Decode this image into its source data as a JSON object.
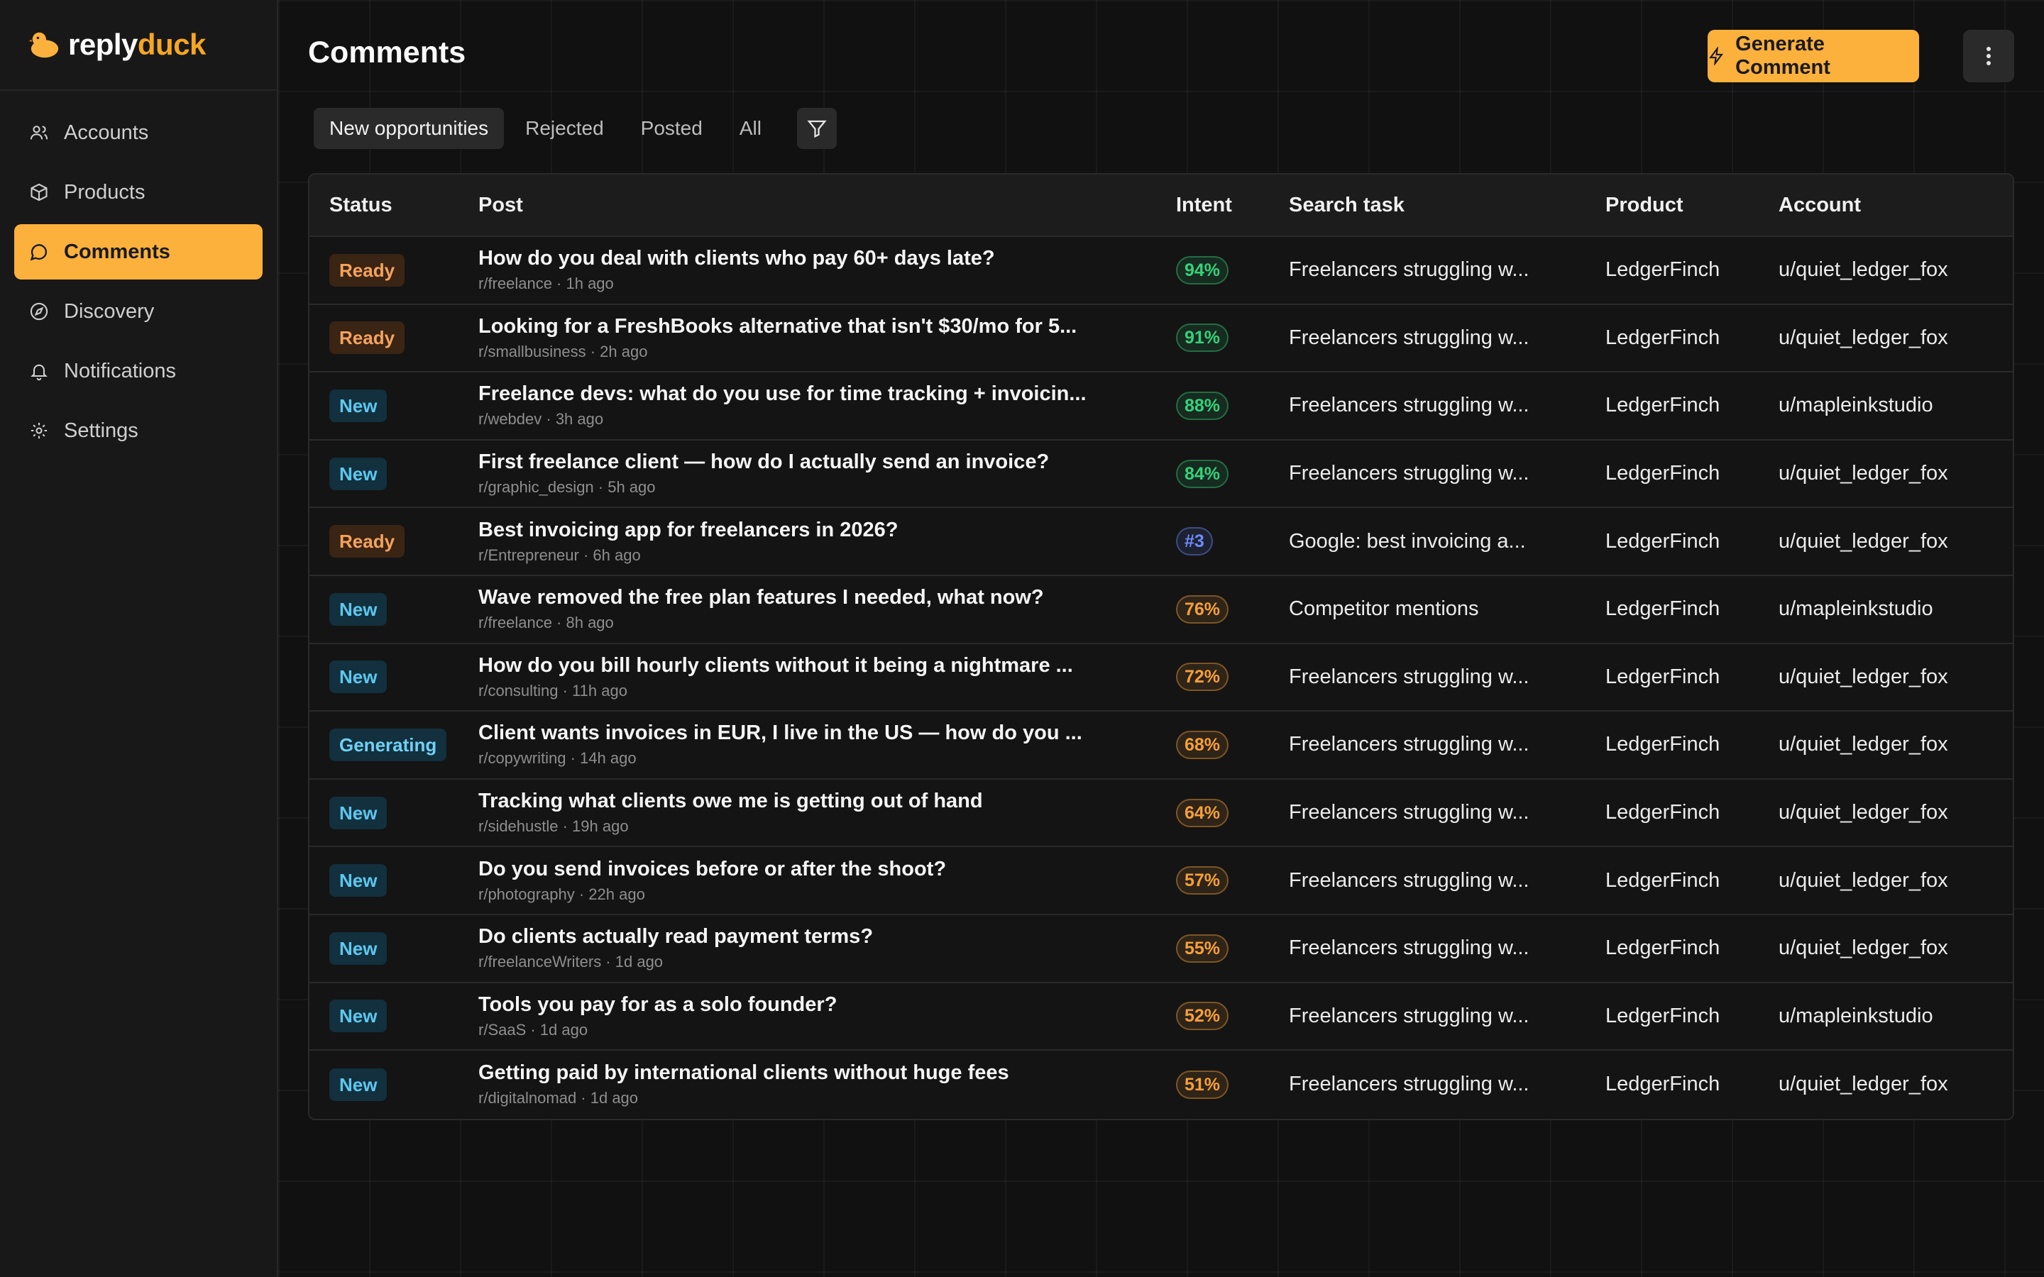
{
  "app": {
    "brand_part1": "reply",
    "brand_part2": "duck",
    "brand_color": "#f5a623"
  },
  "sidebar": {
    "items": [
      {
        "label": "Accounts",
        "icon": "users-icon"
      },
      {
        "label": "Products",
        "icon": "box-icon"
      },
      {
        "label": "Comments",
        "icon": "chat-icon",
        "active": true
      },
      {
        "label": "Discovery",
        "icon": "compass-icon"
      },
      {
        "label": "Notifications",
        "icon": "bell-icon"
      },
      {
        "label": "Settings",
        "icon": "gear-icon"
      }
    ]
  },
  "header": {
    "title": "Comments",
    "generate_label": "Generate Comment"
  },
  "tabs": [
    {
      "label": "New opportunities",
      "active": true
    },
    {
      "label": "Rejected"
    },
    {
      "label": "Posted"
    },
    {
      "label": "All"
    }
  ],
  "table": {
    "columns": [
      "Status",
      "Post",
      "Intent",
      "Search task",
      "Product",
      "Account"
    ],
    "rows": [
      {
        "status": "Ready",
        "title": "How do you deal with clients who pay 60+ days late?",
        "meta": "r/freelance · 1h ago",
        "intent": "94%",
        "intent_level": "high",
        "task": "Freelancers struggling w...",
        "product": "LedgerFinch",
        "account": "u/quiet_ledger_fox"
      },
      {
        "status": "Ready",
        "title": "Looking for a FreshBooks alternative that isn't $30/mo for 5...",
        "meta": "r/smallbusiness · 2h ago",
        "intent": "91%",
        "intent_level": "high",
        "task": "Freelancers struggling w...",
        "product": "LedgerFinch",
        "account": "u/quiet_ledger_fox"
      },
      {
        "status": "New",
        "title": "Freelance devs: what do you use for time tracking + invoicin...",
        "meta": "r/webdev · 3h ago",
        "intent": "88%",
        "intent_level": "high",
        "task": "Freelancers struggling w...",
        "product": "LedgerFinch",
        "account": "u/mapleinkstudio"
      },
      {
        "status": "New",
        "title": "First freelance client — how do I actually send an invoice?",
        "meta": "r/graphic_design · 5h ago",
        "intent": "84%",
        "intent_level": "high",
        "task": "Freelancers struggling w...",
        "product": "LedgerFinch",
        "account": "u/quiet_ledger_fox"
      },
      {
        "status": "Ready",
        "title": "Best invoicing app for freelancers in 2026?",
        "meta": "r/Entrepreneur · 6h ago",
        "intent": "#3",
        "intent_level": "rank",
        "task": "Google: best invoicing a...",
        "product": "LedgerFinch",
        "account": "u/quiet_ledger_fox"
      },
      {
        "status": "New",
        "title": "Wave removed the free plan features I needed, what now?",
        "meta": "r/freelance · 8h ago",
        "intent": "76%",
        "intent_level": "medium",
        "task": "Competitor mentions",
        "product": "LedgerFinch",
        "account": "u/mapleinkstudio"
      },
      {
        "status": "New",
        "title": "How do you bill hourly clients without it being a nightmare ...",
        "meta": "r/consulting · 11h ago",
        "intent": "72%",
        "intent_level": "medium",
        "task": "Freelancers struggling w...",
        "product": "LedgerFinch",
        "account": "u/quiet_ledger_fox"
      },
      {
        "status": "Generating",
        "title": "Client wants invoices in EUR, I live in the US — how do you ...",
        "meta": "r/copywriting · 14h ago",
        "intent": "68%",
        "intent_level": "medium",
        "task": "Freelancers struggling w...",
        "product": "LedgerFinch",
        "account": "u/quiet_ledger_fox"
      },
      {
        "status": "New",
        "title": "Tracking what clients owe me is getting out of hand",
        "meta": "r/sidehustle · 19h ago",
        "intent": "64%",
        "intent_level": "medium",
        "task": "Freelancers struggling w...",
        "product": "LedgerFinch",
        "account": "u/quiet_ledger_fox"
      },
      {
        "status": "New",
        "title": "Do you send invoices before or after the shoot?",
        "meta": "r/photography · 22h ago",
        "intent": "57%",
        "intent_level": "medium",
        "task": "Freelancers struggling w...",
        "product": "LedgerFinch",
        "account": "u/quiet_ledger_fox"
      },
      {
        "status": "New",
        "title": "Do clients actually read payment terms?",
        "meta": "r/freelanceWriters · 1d ago",
        "intent": "55%",
        "intent_level": "medium",
        "task": "Freelancers struggling w...",
        "product": "LedgerFinch",
        "account": "u/quiet_ledger_fox"
      },
      {
        "status": "New",
        "title": "Tools you pay for as a solo founder?",
        "meta": "r/SaaS · 1d ago",
        "intent": "52%",
        "intent_level": "medium",
        "task": "Freelancers struggling w...",
        "product": "LedgerFinch",
        "account": "u/mapleinkstudio"
      },
      {
        "status": "New",
        "title": "Getting paid by international clients without huge fees",
        "meta": "r/digitalnomad · 1d ago",
        "intent": "51%",
        "intent_level": "medium",
        "task": "Freelancers struggling w...",
        "product": "LedgerFinch",
        "account": "u/quiet_ledger_fox"
      }
    ]
  },
  "colors": {
    "accent": "#fbb13c",
    "status_ready_bg": "#3a2414",
    "status_ready_fg": "#f5a35c",
    "status_new_bg": "#12303d",
    "status_new_fg": "#5cc8f0",
    "status_generating_bg": "#12303d",
    "status_generating_fg": "#6fd0f5",
    "intent_high": "#34d27a",
    "intent_medium": "#f5a03a",
    "intent_rank": "#6c8cff"
  }
}
